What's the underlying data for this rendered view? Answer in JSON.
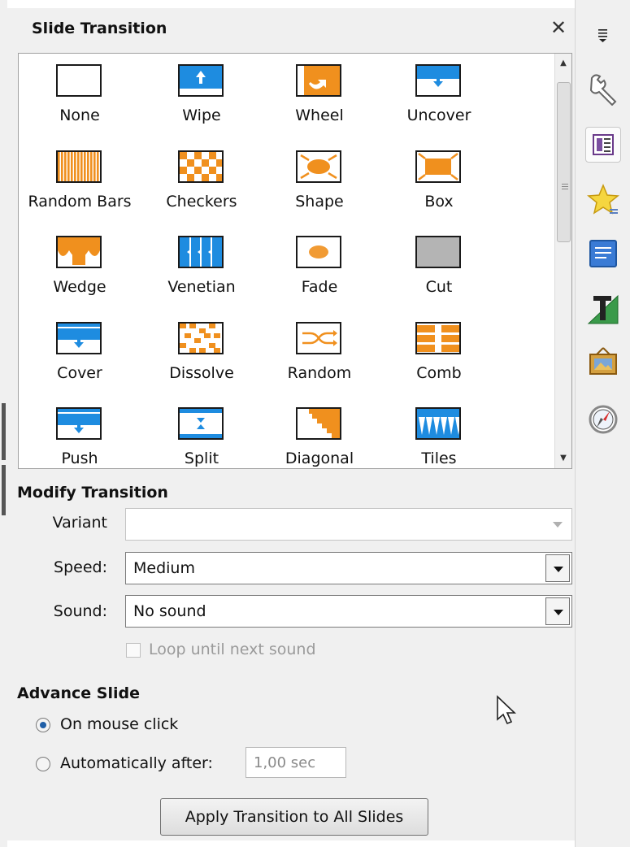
{
  "panel": {
    "title": "Slide Transition",
    "close_icon": "close-icon"
  },
  "transitions": [
    {
      "label": "None",
      "icon": "transition-none-icon"
    },
    {
      "label": "Wipe",
      "icon": "transition-wipe-icon"
    },
    {
      "label": "Wheel",
      "icon": "transition-wheel-icon"
    },
    {
      "label": "Uncover",
      "icon": "transition-uncover-icon"
    },
    {
      "label": "Random Bars",
      "icon": "transition-random-bars-icon"
    },
    {
      "label": "Checkers",
      "icon": "transition-checkers-icon"
    },
    {
      "label": "Shape",
      "icon": "transition-shape-icon"
    },
    {
      "label": "Box",
      "icon": "transition-box-icon"
    },
    {
      "label": "Wedge",
      "icon": "transition-wedge-icon"
    },
    {
      "label": "Venetian",
      "icon": "transition-venetian-icon"
    },
    {
      "label": "Fade",
      "icon": "transition-fade-icon"
    },
    {
      "label": "Cut",
      "icon": "transition-cut-icon"
    },
    {
      "label": "Cover",
      "icon": "transition-cover-icon"
    },
    {
      "label": "Dissolve",
      "icon": "transition-dissolve-icon"
    },
    {
      "label": "Random",
      "icon": "transition-random-icon"
    },
    {
      "label": "Comb",
      "icon": "transition-comb-icon"
    },
    {
      "label": "Push",
      "icon": "transition-push-icon"
    },
    {
      "label": "Split",
      "icon": "transition-split-icon"
    },
    {
      "label": "Diagonal",
      "icon": "transition-diagonal-icon"
    },
    {
      "label": "Tiles",
      "icon": "transition-tiles-icon"
    }
  ],
  "modify": {
    "title": "Modify Transition",
    "variant_label": "Variant",
    "variant_value": "",
    "speed_label": "Speed:",
    "speed_value": "Medium",
    "sound_label": "Sound:",
    "sound_value": "No sound",
    "loop_label": "Loop until next sound",
    "loop_checked": false
  },
  "advance": {
    "title": "Advance Slide",
    "on_click_label": "On mouse click",
    "on_click_selected": true,
    "auto_label": "Automatically after:",
    "auto_selected": false,
    "auto_value": "1,00 sec"
  },
  "apply_button": "Apply Transition to All Slides",
  "sidebar_icons": [
    "sidebar-menu-icon",
    "properties-wrench-icon",
    "slide-transition-icon",
    "animation-star-icon",
    "master-slides-icon",
    "styles-icon",
    "gallery-icon",
    "navigator-icon"
  ],
  "colors": {
    "accent_orange": "#f0901e",
    "accent_blue": "#1e8ce0",
    "panel_bg": "#f0f0f0"
  }
}
